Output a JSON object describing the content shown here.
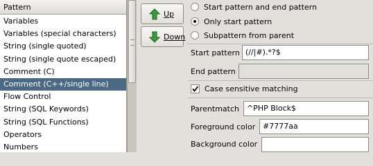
{
  "list": {
    "header": "Pattern",
    "items": [
      {
        "label": "Variables",
        "selected": false
      },
      {
        "label": "Variables (special characters)",
        "selected": false
      },
      {
        "label": "String (single quoted)",
        "selected": false
      },
      {
        "label": "String (single quote escaped)",
        "selected": false
      },
      {
        "label": "Comment (C)",
        "selected": false
      },
      {
        "label": "Comment (C++/single line)",
        "selected": true
      },
      {
        "label": "Flow Control",
        "selected": false
      },
      {
        "label": "String (SQL Keywords)",
        "selected": false
      },
      {
        "label": "String (SQL Functions)",
        "selected": false
      },
      {
        "label": "Operators",
        "selected": false
      },
      {
        "label": "Numbers",
        "selected": false
      }
    ]
  },
  "buttons": {
    "up_label": "Up",
    "down_label": "Down"
  },
  "radios": {
    "start_end": "Start pattern and end pattern",
    "only_start": "Only start pattern",
    "subpattern": "Subpattern from parent",
    "selected": "only_start"
  },
  "fields": {
    "start_pattern_label": "Start pattern",
    "start_pattern_value": "(//|#).*?$",
    "end_pattern_label": "End pattern",
    "end_pattern_value": "",
    "case_sensitive_label": "Case sensitive matching",
    "case_sensitive_checked": true,
    "parentmatch_label": "Parentmatch",
    "parentmatch_value": "^PHP Block$",
    "foreground_label": "Foreground color",
    "foreground_value": "#7777aa",
    "background_label": "Background color",
    "background_value": ""
  },
  "colors": {
    "selection": "#4b6983",
    "arrow_green": "#3e9a3e"
  }
}
